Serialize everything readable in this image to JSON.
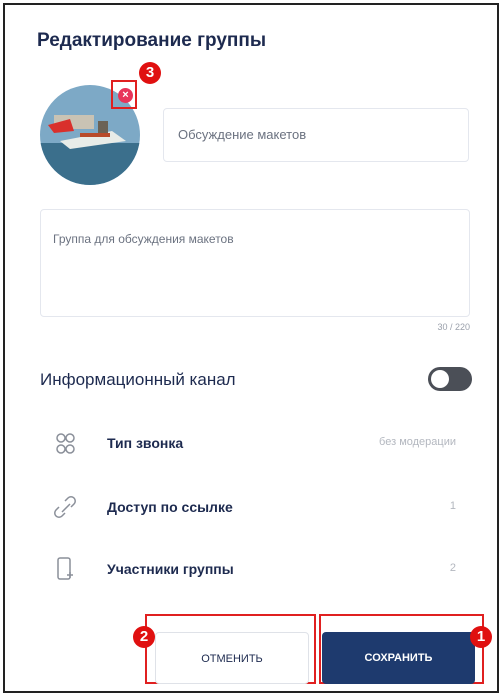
{
  "dialog": {
    "title": "Редактирование группы",
    "group_name": "Обсуждение макетов",
    "description": "Группа для обсуждения макетов",
    "description_counter": "30 / 220",
    "info_channel_label": "Информационный канал",
    "info_channel_enabled": false
  },
  "settings": [
    {
      "label": "Тип звонка",
      "value": "без модерации",
      "icon": "people-icon"
    },
    {
      "label": "Доступ по ссылке",
      "value": "1",
      "icon": "link-icon"
    },
    {
      "label": "Участники группы",
      "value": "2",
      "icon": "add-member-icon"
    }
  ],
  "buttons": {
    "cancel": "ОТМЕНИТЬ",
    "save": "СОХРАНИТЬ"
  },
  "markers": {
    "save": "1",
    "cancel": "2",
    "remove_avatar": "3"
  },
  "colors": {
    "accent": "#1e3a6e",
    "marker": "#e01010",
    "remove": "#e8355a"
  }
}
